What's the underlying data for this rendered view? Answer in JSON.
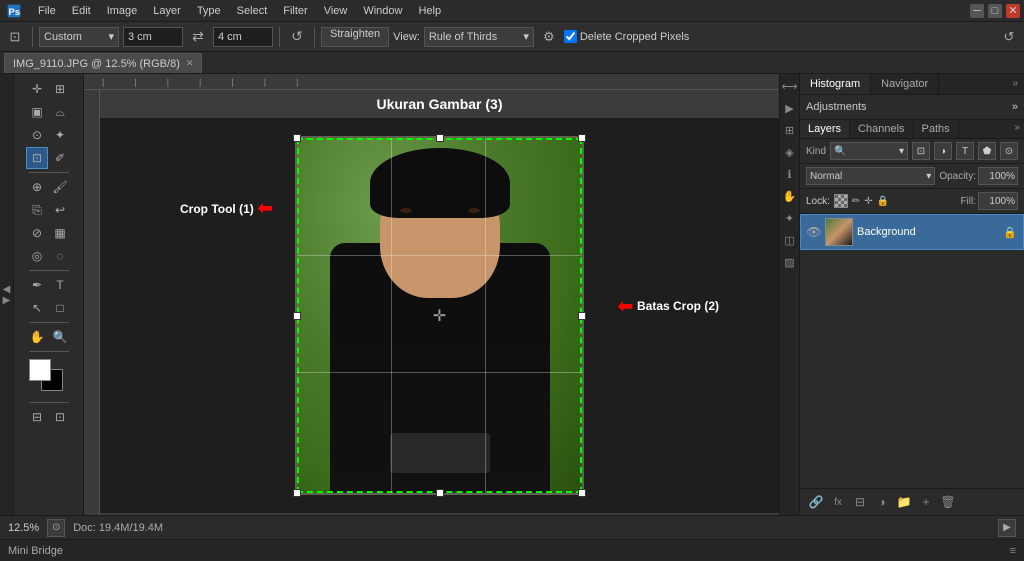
{
  "app": {
    "title": "Adobe Photoshop"
  },
  "menubar": {
    "items": [
      "PS",
      "File",
      "Edit",
      "Image",
      "Layer",
      "Type",
      "Select",
      "Filter",
      "View",
      "Window",
      "Help"
    ]
  },
  "toolbar": {
    "crop_preset": "Custom",
    "width_value": "3 cm",
    "height_value": "4 cm",
    "straighten_label": "Straighten",
    "view_label": "View:",
    "view_dropdown": "Rule of Thirds",
    "settings_label": "⚙",
    "delete_cropped_label": "Delete Cropped Pixels",
    "reset_icon": "↺"
  },
  "tabs": [
    {
      "label": "IMG_9110.JPG @ 12.5% (RGB/8)",
      "active": true,
      "closeable": true
    }
  ],
  "canvas": {
    "title": "Ukuran Gambar  (3)",
    "zoom": "12.5%",
    "doc_info": "Doc: 19.4M/19.4M"
  },
  "annotations": {
    "crop_tool": "Crop Tool  (1)",
    "batas_crop": "Batas Crop  (2)"
  },
  "right_panel": {
    "top_tabs": [
      "Histogram",
      "Navigator"
    ],
    "adjustments_label": "Adjustments",
    "layers_tabs": [
      "Layers",
      "Channels",
      "Paths"
    ],
    "kind_label": "Kind",
    "blend_mode": "Normal",
    "opacity_label": "Opacity:",
    "opacity_value": "100%",
    "lock_label": "Lock:",
    "fill_label": "Fill:",
    "fill_value": "100%",
    "layer_name": "Background"
  },
  "status_bar": {
    "zoom": "12.5%",
    "doc_info": "Doc: 19.4M/19.4M"
  },
  "mini_bridge": {
    "label": "Mini Bridge"
  }
}
